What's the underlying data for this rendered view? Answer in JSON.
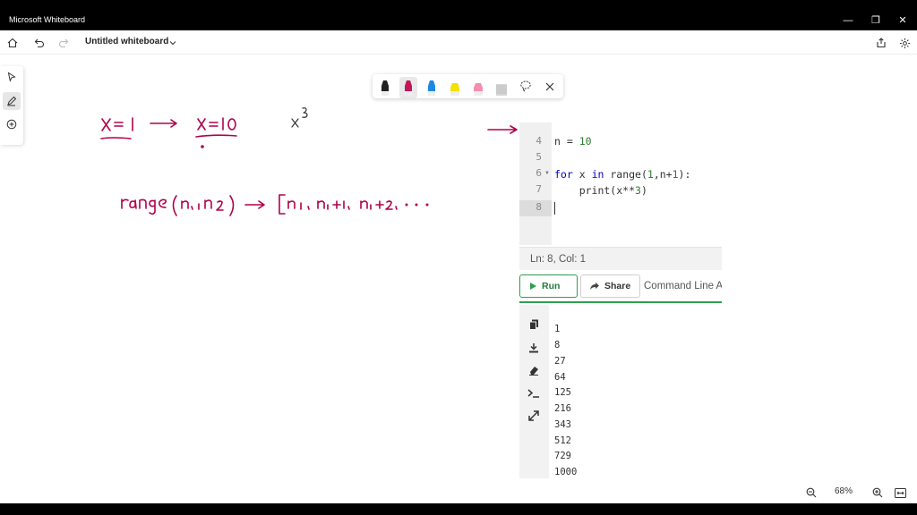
{
  "window": {
    "app_title": "Microsoft Whiteboard",
    "minimize_glyph": "—",
    "restore_glyph": "❐",
    "close_glyph": "✕"
  },
  "toolbar": {
    "doc_title": "Untitled whiteboard"
  },
  "pen_palette": {
    "pen_colors": [
      "#222222",
      "#c2185b",
      "#1e88e5",
      "#f4e100",
      "#f48fb1",
      "#c8c8c8"
    ]
  },
  "ink": {
    "accent_color": "#b0004a"
  },
  "editor": {
    "lines": [
      {
        "num": "4",
        "text": "n = 10"
      },
      {
        "num": "5",
        "text": ""
      },
      {
        "num": "6",
        "text": "for x in range(1,n+1):"
      },
      {
        "num": "7",
        "text": "    print(x**3)"
      },
      {
        "num": "8",
        "text": ""
      }
    ],
    "status": "Ln: 8,  Col: 1"
  },
  "run_bar": {
    "run_label": "Run",
    "share_label": "Share",
    "cmd_tab_label": "Command Line A"
  },
  "output": {
    "lines": [
      "1",
      "8",
      "27",
      "64",
      "125",
      "216",
      "343",
      "512",
      "729",
      "1000"
    ]
  },
  "zoom": {
    "level": "68%"
  }
}
